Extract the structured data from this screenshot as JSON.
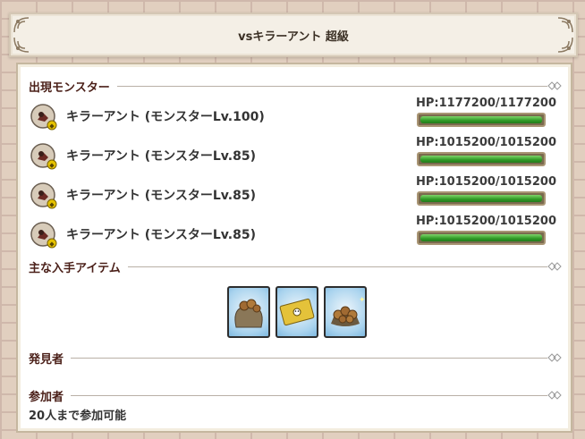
{
  "header": {
    "title": "vsキラーアント 超級"
  },
  "sections": {
    "monsters": {
      "label": "出現モンスター"
    },
    "items": {
      "label": "主な入手アイテム"
    },
    "discoverer": {
      "label": "発見者"
    },
    "participants": {
      "label": "参加者",
      "text": "20人まで参加可能"
    }
  },
  "monsters": [
    {
      "name": "キラーアント (モンスターLv.100)",
      "hp_text": "HP:1177200/1177200",
      "hp_fraction": 1.0
    },
    {
      "name": "キラーアント (モンスターLv.85)",
      "hp_text": "HP:1015200/1015200",
      "hp_fraction": 1.0
    },
    {
      "name": "キラーアント (モンスターLv.85)",
      "hp_text": "HP:1015200/1015200",
      "hp_fraction": 1.0
    },
    {
      "name": "キラーアント (モンスターLv.85)",
      "hp_text": "HP:1015200/1015200",
      "hp_fraction": 1.0
    }
  ],
  "item_icons": [
    "nut-sack-icon",
    "gold-ticket-icon",
    "nut-pile-icon"
  ],
  "colors": {
    "hp_green": "#2f9a25",
    "section_label": "#4a1f18",
    "item_bg": "#a9d3ee"
  }
}
